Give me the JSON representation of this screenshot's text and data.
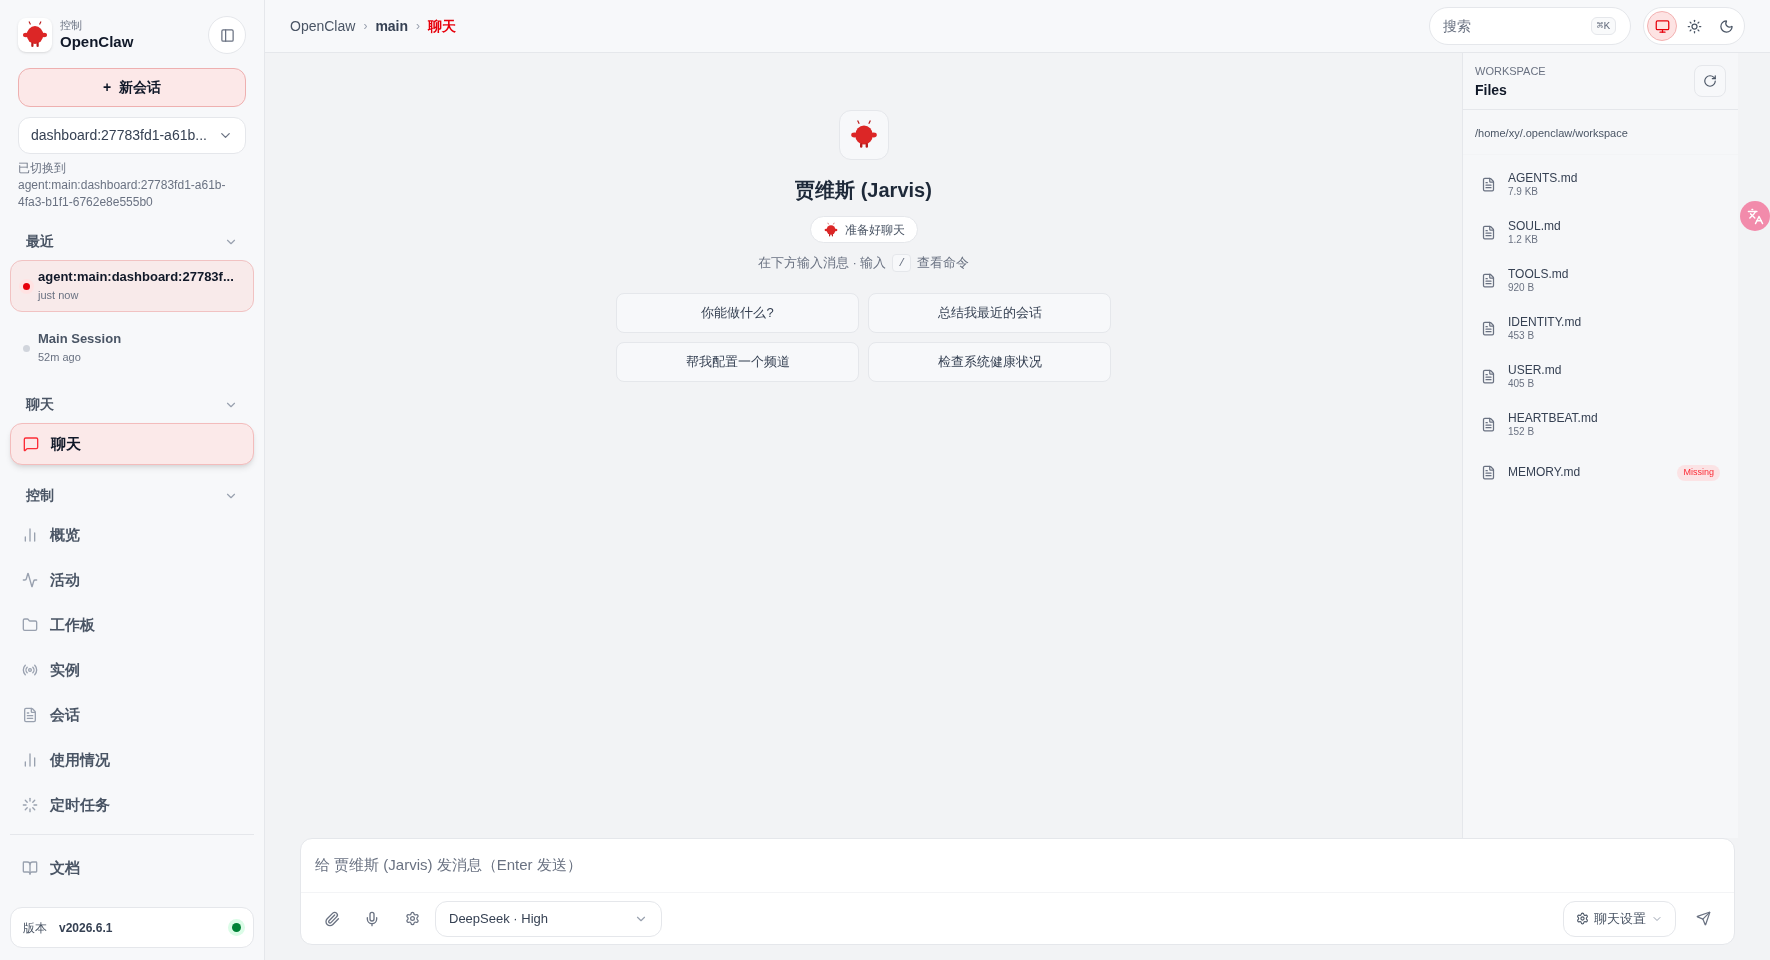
{
  "brand": {
    "caption": "控制",
    "name": "OpenClaw"
  },
  "new_chat_button": {
    "icon": "+",
    "label": "新会话"
  },
  "session_select": {
    "value": "dashboard:27783fd1-a61b..."
  },
  "switch_notice": {
    "label": "已切换到",
    "session": "agent:main:dashboard:27783fd1-a61b-4fa3-b1f1-6762e8e555b0"
  },
  "recent": {
    "title": "最近",
    "expanded": true,
    "sessions": [
      {
        "title": "agent:main:dashboard:27783f...",
        "time": "just now",
        "selected": true
      },
      {
        "title": "Main Session",
        "time": "52m ago",
        "selected": false
      }
    ]
  },
  "chat_section": {
    "title": "聊天",
    "expanded": true,
    "items": [
      {
        "label": "聊天",
        "selected": true
      }
    ]
  },
  "control_section": {
    "title": "控制",
    "expanded": true,
    "items": [
      {
        "label": "概览",
        "selected": false
      },
      {
        "label": "活动",
        "selected": false
      },
      {
        "label": "工作板",
        "selected": false
      },
      {
        "label": "实例",
        "selected": false
      },
      {
        "label": "会话",
        "selected": false
      },
      {
        "label": "使用情况",
        "selected": false
      },
      {
        "label": "定时任务",
        "selected": false
      }
    ]
  },
  "docs_item": {
    "label": "文档"
  },
  "version": {
    "label": "版本",
    "value": "v2026.6.1",
    "online": true
  },
  "breadcrumb_separator": "›",
  "breadcrumbs": [
    {
      "label": "OpenClaw",
      "current": false
    },
    {
      "label": "main",
      "current": false
    },
    {
      "label": "聊天",
      "current": true
    }
  ],
  "search": {
    "placeholder": "搜索",
    "shortcut": "⌘K"
  },
  "theme_toggle": [
    {
      "selected": true
    },
    {
      "selected": false
    },
    {
      "selected": false
    }
  ],
  "agent": {
    "name": "贾维斯 (Jarvis)",
    "status": "准备好聊天",
    "hint_before": "在下方输入消息 · 输入",
    "hint_key": "/",
    "hint_after": "查看命令"
  },
  "suggestions": [
    "你能做什么?",
    "总结我最近的会话",
    "帮我配置一个频道",
    "检查系统健康状况"
  ],
  "workspace": {
    "caption": "WORKSPACE",
    "title": "Files",
    "path": "/home/xy/.openclaw/workspace",
    "files": [
      {
        "name": "AGENTS.md",
        "size": "7.9 KB"
      },
      {
        "name": "SOUL.md",
        "size": "1.2 KB"
      },
      {
        "name": "TOOLS.md",
        "size": "920 B"
      },
      {
        "name": "IDENTITY.md",
        "size": "453 B"
      },
      {
        "name": "USER.md",
        "size": "405 B"
      },
      {
        "name": "HEARTBEAT.md",
        "size": "152 B"
      },
      {
        "name": "MEMORY.md",
        "status": "Missing"
      }
    ]
  },
  "composer": {
    "placeholder": "给 贾维斯 (Jarvis) 发消息（Enter 发送）",
    "model": "DeepSeek · High",
    "settings": "聊天设置"
  }
}
